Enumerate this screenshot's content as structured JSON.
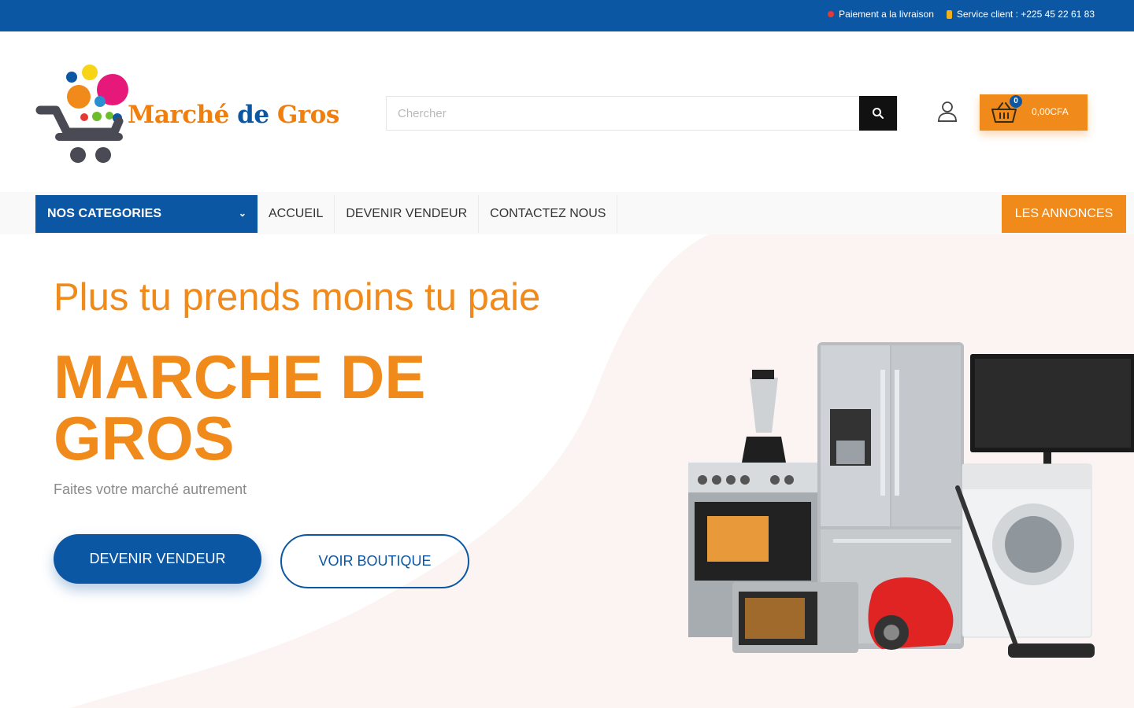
{
  "topbar": {
    "payment_text": "Paiement a la livraison",
    "service_text": "Service client : +225 45 22 61 83"
  },
  "logo": {
    "part1": "Marché ",
    "part2": "de",
    "part3": " Gros"
  },
  "search": {
    "placeholder": "Chercher"
  },
  "cart": {
    "count": "0",
    "amount": "0,00CFA"
  },
  "nav": {
    "categories": "NOS CATEGORIES",
    "links": [
      "ACCUEIL",
      "DEVENIR VENDEUR",
      "CONTACTEZ NOUS"
    ],
    "annonces": "LES ANNONCES"
  },
  "hero": {
    "tagline": "Plus tu prends moins tu paie",
    "headline": "MARCHE DE GROS",
    "subtitle": "Faites votre marché autrement",
    "primary_button": "DEVENIR VENDEUR",
    "secondary_button": "VOIR BOUTIQUE"
  },
  "colors": {
    "brand_blue": "#0b57a4",
    "brand_orange": "#f08a1a"
  },
  "icons": {
    "search": "search-icon",
    "user": "user-icon",
    "cart": "basket-icon",
    "chevron": "chevron-down-icon"
  }
}
